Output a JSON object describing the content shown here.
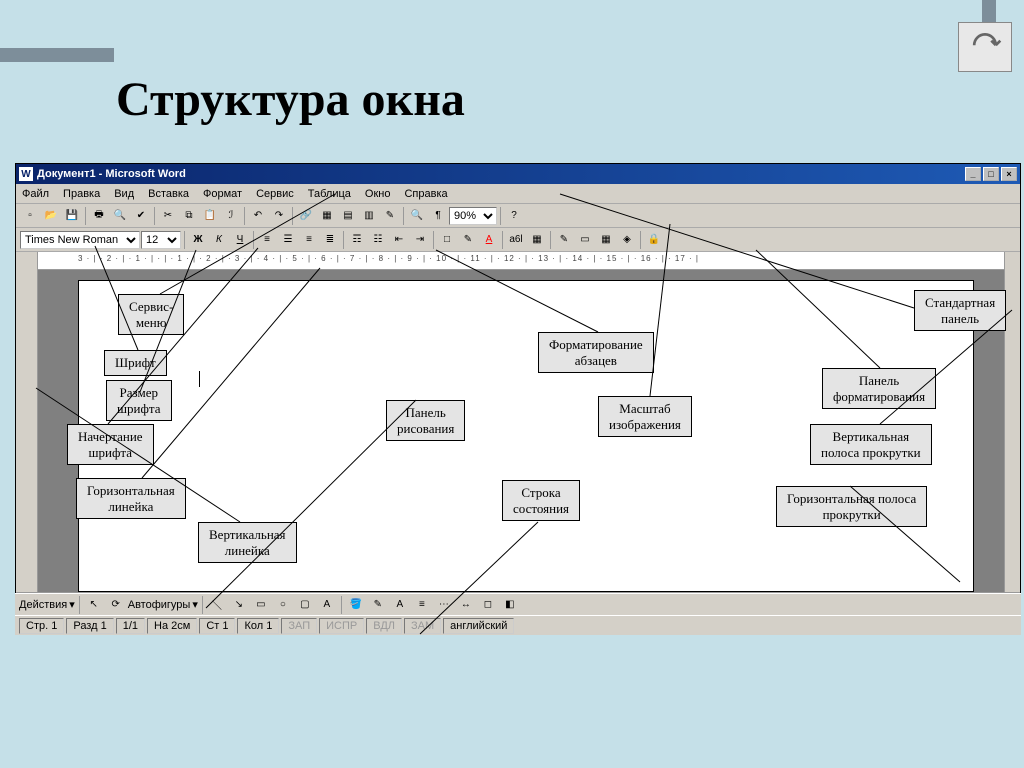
{
  "slide": {
    "title": "Структура окна"
  },
  "word": {
    "titlebar": {
      "icon": "W",
      "text": "Документ1 - Microsoft Word"
    },
    "menu": [
      "Файл",
      "Правка",
      "Вид",
      "Вставка",
      "Формат",
      "Сервис",
      "Таблица",
      "Окно",
      "Справка"
    ],
    "format_bar": {
      "font": "Times New Roman",
      "size": "12",
      "bold": "Ж",
      "italic": "К",
      "underline": "Ч"
    },
    "zoom": "90%",
    "drawing": {
      "actions": "Действия",
      "autoshapes": "Автофигуры"
    },
    "status": {
      "page": "Стр. 1",
      "section": "Разд 1",
      "pages": "1/1",
      "at": "На 2см",
      "line": "Ст 1",
      "col": "Кол 1",
      "rec": "ЗАП",
      "trk": "ИСПР",
      "ext": "ВДЛ",
      "ovr": "ЗАМ",
      "lang": "английский"
    }
  },
  "ruler_text": "3 · | · 2 · | · 1 · | · | · 1 · | · 2 · | · 3 · | · 4 · | · 5 · | · 6 · | · 7 · | · 8 · | · 9 · | · 10 · | · 11 · | · 12 · | · 13 · | · 14 · | · 15 · | · 16 · | · 17 · |",
  "callouts": {
    "service_menu": "Сервис-\nменю",
    "font": "Шрифт",
    "font_size": "Размер\nшрифта",
    "font_style": "Начертание\nшрифта",
    "h_ruler": "Горизонтальная\nлинейка",
    "v_ruler": "Вертикальная\nлинейка",
    "draw_panel": "Панель\nрисования",
    "status_line": "Строка\nсостояния",
    "para_format": "Форматирование\nабзацев",
    "scale": "Масштаб\nизображения",
    "std_panel": "Стандартная\nпанель",
    "format_panel": "Панель\nформатирования",
    "v_scroll": "Вертикальная\nполоса прокрутки",
    "h_scroll": "Горизонтальная полоса\nпрокрутки"
  }
}
